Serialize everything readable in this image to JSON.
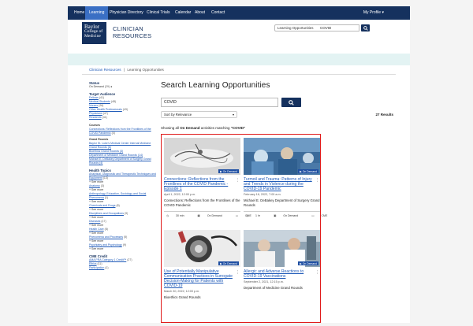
{
  "nav": {
    "items": [
      "Home",
      "Learning",
      "Physician Directory",
      "Clinical Trials",
      "Calendar",
      "About",
      "Contact"
    ],
    "profile": "My Profile ▾"
  },
  "logo": {
    "line1": "Baylor",
    "line2": "College of",
    "line3": "Medicine"
  },
  "brand": {
    "line1": "CLINICIAN",
    "line2": "RESOURCES"
  },
  "quick_search": {
    "scope": "Learning Opportunities",
    "value": "COVID"
  },
  "breadcrumb": {
    "root": "Clinician Resources",
    "separator": "|",
    "current": "Learning Opportunities"
  },
  "sidebar": {
    "status_heading": "Status",
    "status_value": "On Demand",
    "status_count": "(29)",
    "audience_heading": "Target Audience",
    "audience": [
      {
        "label": "Fellows",
        "count": "(41)"
      },
      {
        "label": "Medical Students",
        "count": "(48)"
      },
      {
        "label": "Nurses",
        "count": "(26)"
      },
      {
        "label": "Other Health Professionals",
        "count": "(43)"
      },
      {
        "label": "Physicians",
        "count": "(47)"
      },
      {
        "label": "Residents",
        "count": "(41)"
      }
    ],
    "courses_heading": "Courses",
    "courses": [
      "Connections: Reflections from the Frontlines of the COVID Pandemic",
      "(4)"
    ],
    "grand_heading": "Grand Rounds",
    "grand": [
      "Baylor St. Luke's Medical Center Internal Medicine Grand Rounds (6)",
      "Bioethics Grand Rounds (3)",
      "Department of Medicine Grand Rounds (14)",
      "Michael E. DeBakey Department of Surgery Grand Rounds (4)"
    ],
    "topics_heading": "Health Topics",
    "topics": [
      {
        "label": "Analytical, Diagnostic and Therapeutic Techniques and Equipment",
        "count": "(13)"
      },
      {
        "label": "Anatomy",
        "count": "(3)"
      },
      {
        "label": "Anthropology, Education, Sociology and Social Phenomena",
        "count": "(1)"
      },
      {
        "label": "Chemicals and Drugs",
        "count": "(8)"
      },
      {
        "label": "Disciplines and Occupations",
        "count": "(9)"
      },
      {
        "label": "Diseases",
        "count": "(17)"
      },
      {
        "label": "Health Care",
        "count": "(8)"
      },
      {
        "label": "Phenomena and Processes",
        "count": "(5)"
      },
      {
        "label": "Psychiatry and Psychology",
        "count": "(9)"
      }
    ],
    "see_more": "+ See more",
    "credit_heading": "CME Credit",
    "credits": [
      {
        "label": "AMA PRA Category 1 Credit™",
        "count": "(27)"
      },
      {
        "label": "Ethics",
        "count": "(11)"
      },
      {
        "label": "Participation",
        "count": "(1)"
      }
    ]
  },
  "main": {
    "title": "Search Learning Opportunities",
    "search_value": "COVID",
    "sort_label": "Sort by Relevance",
    "results": "27 Results",
    "showing_prefix": "Showing all ",
    "showing_bold": "On Demand",
    "showing_mid": " activities matching ",
    "showing_query": "\"COVID\""
  },
  "cards": [
    {
      "badge": "On Demand",
      "title": "Connections: Reflections from the Frontlines of the COVID Pandemic - Episode 1",
      "date": "April 1, 2022, 12:00 p.m.",
      "desc": "Connections: Reflections from the Frontlines of the COVID Pandemic",
      "meta": [
        "30 min",
        "On Demand",
        "CME"
      ]
    },
    {
      "badge": "On Demand",
      "title": "Turmoil and Trauma: Patterns of Injury and Trends in Violence during the COVID-19 Pandemic",
      "date": "February 16, 2022, 7:00 a.m.",
      "desc": "Michael E. DeBakey Department of Surgery Grand Rounds",
      "meta": [
        "1 hr",
        "On Demand",
        "CME"
      ]
    },
    {
      "badge": "On Demand",
      "title": "Use of Potentially Manipulative Communication Practices in Surrogate Decision-Making for Patients with COVID-19",
      "date": "March 30, 2022, 12:00 p.m.",
      "desc": "Bioethics Grand Rounds",
      "meta": []
    },
    {
      "badge": "On Demand",
      "title": "Allergic and Adverse Reactions to COVID-19 Vaccinations",
      "date": "September 2, 2021, 12:15 p.m.",
      "desc": "Department of Medicine Grand Rounds",
      "meta": []
    }
  ],
  "colors": {
    "navy": "#15315e",
    "link": "#1f5ab8",
    "highlight": "#e01b1b",
    "band": "#e3f3f3"
  }
}
